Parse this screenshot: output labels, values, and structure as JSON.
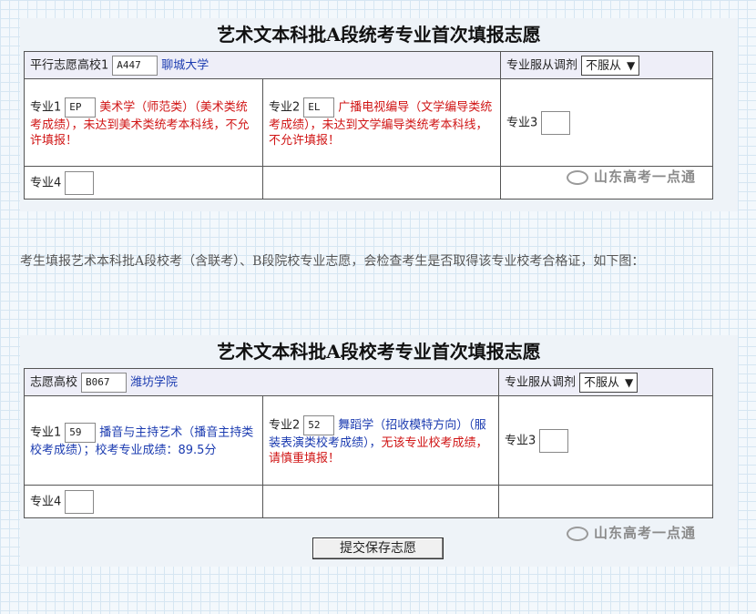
{
  "form1": {
    "title": "艺术文本科批A段统考专业首次填报志愿",
    "school_label": "平行志愿高校1",
    "school_code": "A447",
    "school_name": "聊城大学",
    "adjust_label": "专业服从调剂",
    "adjust_value": "不服从",
    "major1_label": "专业1",
    "major1_code": "EP",
    "major1_name": "美术学（师范类）",
    "major1_error": "（美术类统考成绩），未达到美术类统考本科线，不允许填报！",
    "major2_label": "专业2",
    "major2_code": "EL",
    "major2_name": "广播电视编导（文学编导类统考成绩），未达到文学编导类统考本科线，不允许填报！",
    "major3_label": "专业3",
    "major4_label": "专业4"
  },
  "paragraph": "考生填报艺术本科批A段校考（含联考）、B段院校专业志愿，会检查考生是否取得该专业校考合格证，如下图：",
  "form2": {
    "title": "艺术文本科批A段校考专业首次填报志愿",
    "school_label": "志愿高校",
    "school_code": "B067",
    "school_name": "潍坊学院",
    "adjust_label": "专业服从调剂",
    "adjust_value": "不服从",
    "major1_label": "专业1",
    "major1_code": "59",
    "major1_name": "播音与主持艺术（播音主持类校考成绩）；校考专业成绩：89.5分",
    "major2_label": "专业2",
    "major2_code": "52",
    "major2_name": "舞蹈学（招收模特方向）（服装表演类校考成绩），",
    "major2_error": "无该专业校考成绩，请慎重填报！",
    "major3_label": "专业3",
    "major4_label": "专业4"
  },
  "submit_label": "提交保存志愿",
  "watermark": "山东高考一点通",
  "colors": {
    "link_blue": "#1b3bb0",
    "error_red": "#d01515",
    "header_bg": "#eeeef8"
  }
}
